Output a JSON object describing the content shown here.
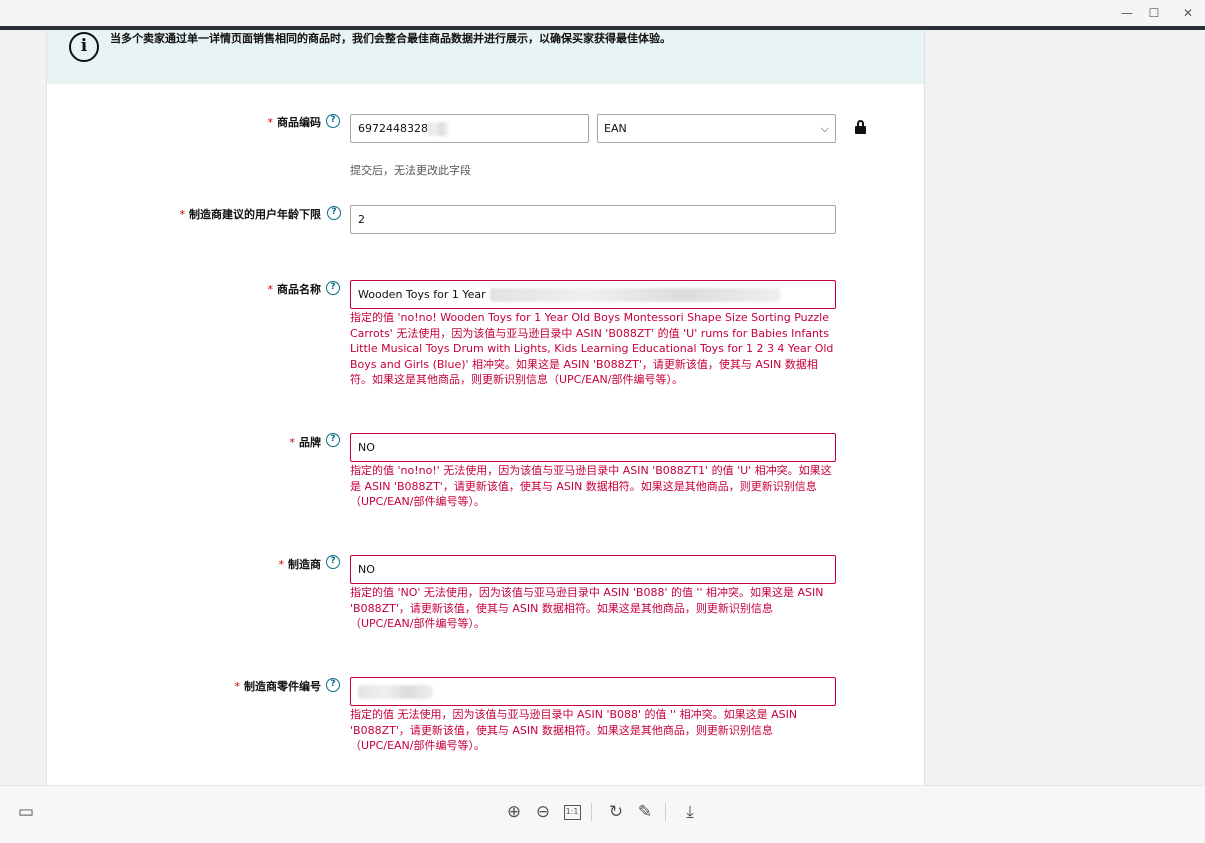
{
  "window": {
    "minimize": "—",
    "maximize": "☐",
    "close": "✕"
  },
  "banner": {
    "text": "当多个卖家通过单一详情页面销售相同的商品时，我们会整合最佳商品数据并进行展示，以确保买家获得最佳体验。"
  },
  "form": {
    "required_mark": "*",
    "help_glyph": "?",
    "product_id": {
      "label": "商品编码",
      "value": "6972448328",
      "type_value": "EAN",
      "hint": "提交后，无法更改此字段"
    },
    "min_age": {
      "label": "制造商建议的用户年龄下限",
      "value": "2"
    },
    "item_name": {
      "label": "商品名称",
      "value": "Wooden Toys for 1 Year",
      "error": "指定的值 'no!no! Wooden Toys for 1 Year Old Boys Montessori Shape Size Sorting Puzzle Carrots' 无法使用，因为该值与亚马逊目录中 ASIN 'B088ZT' 的值 'U' rums for Babies Infants Little Musical Toys Drum with Lights, Kids Learning Educational Toys for 1 2 3 4 Year Old Boys and Girls (Blue)' 相冲突。如果这是 ASIN 'B088ZT'，请更新该值，使其与 ASIN 数据相符。如果这是其他商品，则更新识别信息（UPC/EAN/部件编号等）。"
    },
    "brand": {
      "label": "品牌",
      "value": "NO",
      "error": "指定的值 'no!no!' 无法使用，因为该值与亚马逊目录中 ASIN 'B088ZT1' 的值 'U' 相冲突。如果这是 ASIN 'B088ZT'，请更新该值，使其与 ASIN 数据相符。如果这是其他商品，则更新识别信息（UPC/EAN/部件编号等）。"
    },
    "manufacturer": {
      "label": "制造商",
      "value": "NO",
      "error": "指定的值 'NO' 无法使用，因为该值与亚马逊目录中 ASIN 'B088' 的值 '' 相冲突。如果这是 ASIN 'B088ZT'，请更新该值，使其与 ASIN 数据相符。如果这是其他商品，则更新识别信息（UPC/EAN/部件编号等）。"
    },
    "part_number": {
      "label": "制造商零件编号",
      "value": "",
      "error": "指定的值 无法使用，因为该值与亚马逊目录中 ASIN 'B088' 的值 '' 相冲突。如果这是 ASIN 'B088ZT'，请更新该值，使其与 ASIN 数据相符。如果这是其他商品，则更新识别信息（UPC/EAN/部件编号等）。"
    }
  },
  "toolbar": {
    "panel": "▭",
    "zoom_in": "⊕",
    "zoom_out": "⊖",
    "fit": "1:1",
    "rotate": "↻",
    "edit": "✎",
    "download": "⤓"
  },
  "colors": {
    "error": "#c7003a",
    "banner_bg": "#e8f3f3",
    "help": "#0a6f87"
  }
}
